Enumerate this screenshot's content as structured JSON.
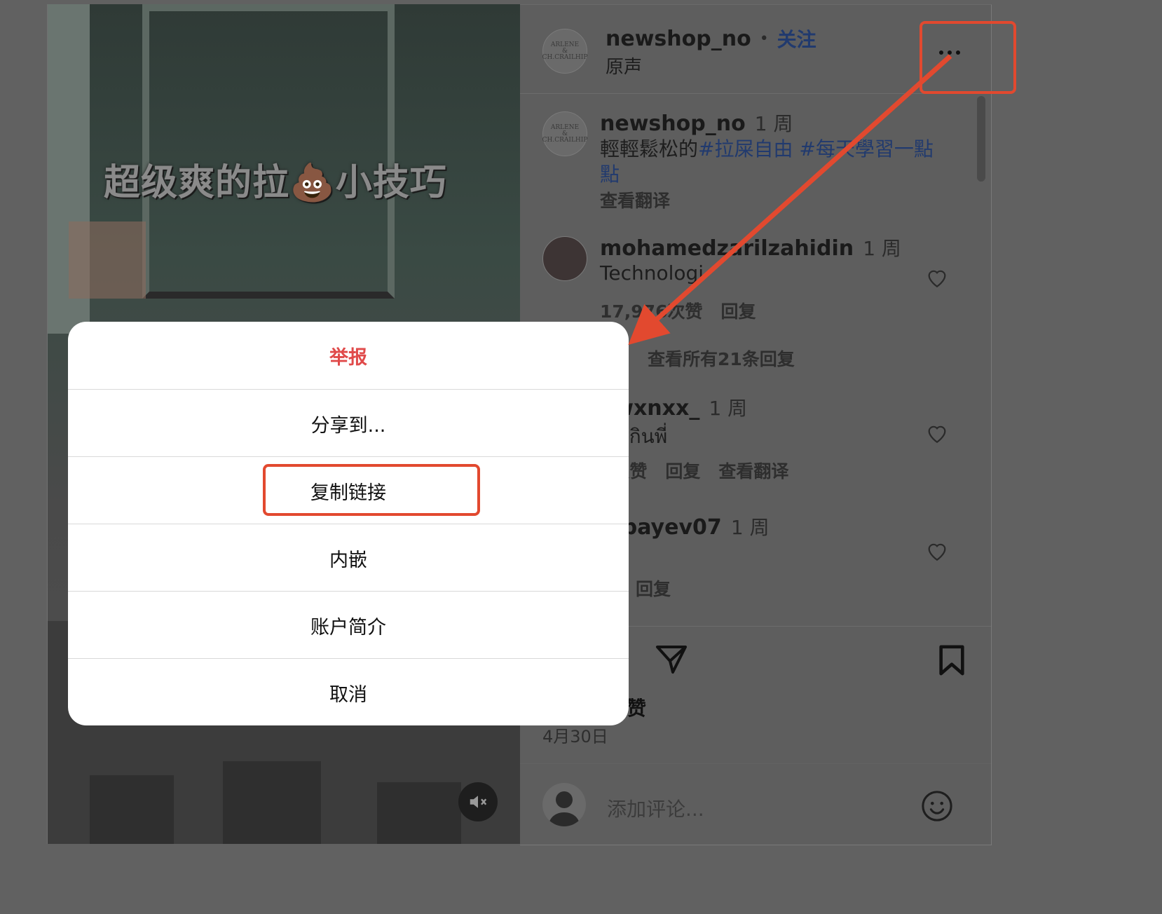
{
  "video": {
    "overlay_text": "超级爽的拉💩小技巧",
    "mute_icon": "speaker-muted-icon"
  },
  "header": {
    "username": "newshop_no",
    "separator": "•",
    "follow_label": "关注",
    "audio_label": "原声",
    "more_icon": "more-options-icon"
  },
  "caption": {
    "username": "newshop_no",
    "time": "1 周",
    "text_prefix": "輕輕鬆松的",
    "hashtags": "#拉屎自由 #每天學習一點",
    "hashtags_cont": "點",
    "translate": "查看翻译"
  },
  "comments": [
    {
      "username": "mohamedzarilzahidin",
      "time": "1 周",
      "text": "Technologi",
      "likes": "17,976次赞",
      "reply": "回复",
      "view_replies": "查看所有21条回复"
    },
    {
      "username": "awxnxx_",
      "time": "1 周",
      "text": "ายเกินพี่",
      "likes": "0次赞",
      "reply": "回复",
      "translate": "查看翻译"
    },
    {
      "username": "dibayev07",
      "time": "1 周",
      "text": "",
      "likes": "赞",
      "reply": "回复"
    }
  ],
  "actions": {
    "share_icon": "send-icon",
    "save_icon": "bookmark-icon",
    "likes_label": "赞",
    "date": "4月30日"
  },
  "add_comment": {
    "placeholder": "添加评论...",
    "emoji_icon": "emoji-icon"
  },
  "modal": {
    "items": [
      "举报",
      "分享到...",
      "复制链接",
      "内嵌",
      "账户简介",
      "取消"
    ]
  },
  "colors": {
    "report_red": "#e04a4a",
    "annotation_red": "#e2492f",
    "link_blue": "#213a6e"
  }
}
